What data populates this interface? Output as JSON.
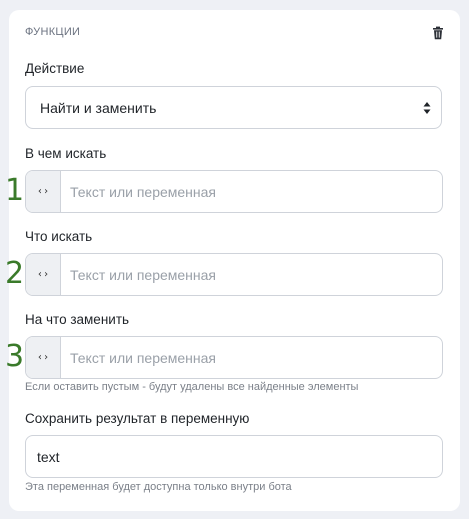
{
  "section": {
    "title": "ФУНКЦИИ",
    "icons": {
      "delete": "trash-icon"
    }
  },
  "action": {
    "label": "Действие",
    "selected": "Найти и заменить"
  },
  "fields": [
    {
      "marker": "1",
      "label": "В чем искать",
      "placeholder": "Текст или переменная",
      "addon": "‹›"
    },
    {
      "marker": "2",
      "label": "Что искать",
      "placeholder": "Текст или переменная",
      "addon": "‹›"
    },
    {
      "marker": "3",
      "label": "На что заменить",
      "placeholder": "Текст или переменная",
      "addon": "‹›",
      "hint": "Если оставить пустым - будут удалены все найденные элементы"
    }
  ],
  "result": {
    "label": "Сохранить результат в переменную",
    "value": "text",
    "hint": "Эта переменная будет доступна только внутри бота"
  },
  "colors": {
    "background": "#eef0f5",
    "card": "#ffffff",
    "border": "#cfd3da",
    "marker": "#3a7a2a"
  }
}
